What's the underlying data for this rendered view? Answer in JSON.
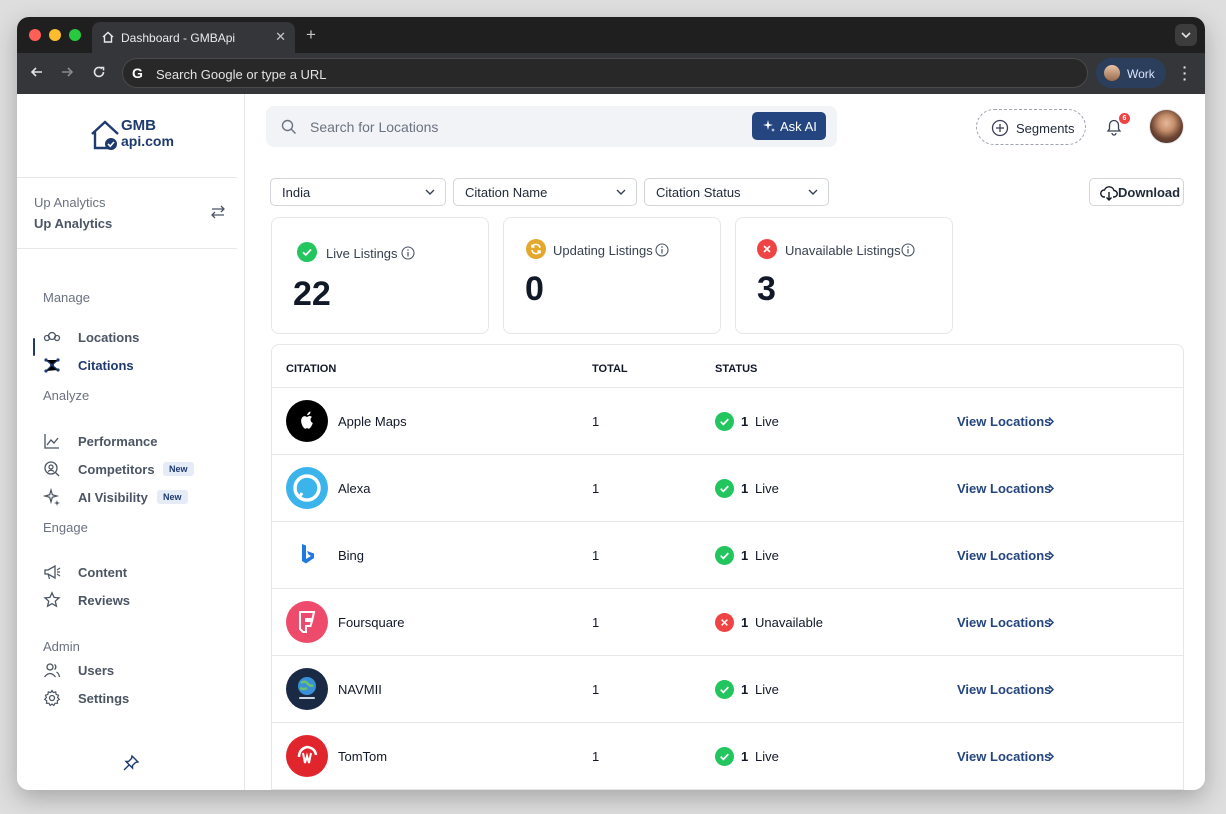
{
  "browser": {
    "tab_title": "Dashboard - GMBApi",
    "omnibox_placeholder": "Search Google or type a URL",
    "profile_label": "Work",
    "omnibox_g": "G"
  },
  "sidebar": {
    "logo_top": "GMB",
    "logo_bottom": "api.com",
    "account_line1": "Up Analytics",
    "account_line2": "Up Analytics",
    "sections": {
      "manage": "Manage",
      "analyze": "Analyze",
      "engage": "Engage",
      "admin": "Admin"
    },
    "items": {
      "locations": "Locations",
      "citations": "Citations",
      "performance": "Performance",
      "competitors": "Competitors",
      "ai_visibility": "AI Visibility",
      "content": "Content",
      "reviews": "Reviews",
      "users": "Users",
      "settings": "Settings"
    },
    "new_badge": "New"
  },
  "header": {
    "search_placeholder": "Search for Locations",
    "ask_ai": "Ask AI",
    "segments": "Segments",
    "notification_count": "6"
  },
  "filters": {
    "country": "India",
    "citation_name": "Citation Name",
    "citation_status": "Citation Status",
    "download": "Download"
  },
  "stats": {
    "live_label": "Live Listings",
    "live_value": "22",
    "updating_label": "Updating Listings",
    "updating_value": "0",
    "unavailable_label": "Unavailable Listings",
    "unavailable_value": "3"
  },
  "table": {
    "headers": {
      "citation": "CITATION",
      "total": "TOTAL",
      "status": "STATUS"
    },
    "view_label": "View Locations",
    "rows": [
      {
        "name": "Apple Maps",
        "total": "1",
        "status_count": "1",
        "status": "Live"
      },
      {
        "name": "Alexa",
        "total": "1",
        "status_count": "1",
        "status": "Live"
      },
      {
        "name": "Bing",
        "total": "1",
        "status_count": "1",
        "status": "Live"
      },
      {
        "name": "Foursquare",
        "total": "1",
        "status_count": "1",
        "status": "Unavailable"
      },
      {
        "name": "NAVMII",
        "total": "1",
        "status_count": "1",
        "status": "Live"
      },
      {
        "name": "TomTom",
        "total": "1",
        "status_count": "1",
        "status": "Live"
      }
    ]
  },
  "colors": {
    "brand": "#1e3a6e",
    "live": "#22c55e",
    "updating": "#e5a82e",
    "unavailable": "#ef4444"
  }
}
